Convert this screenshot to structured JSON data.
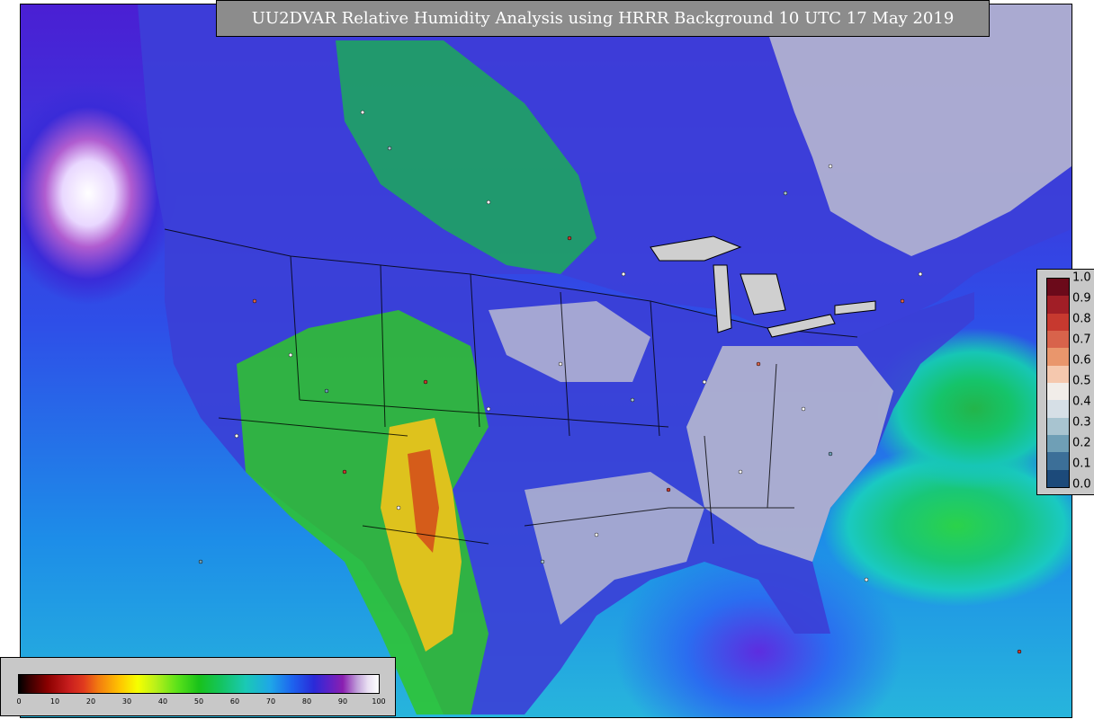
{
  "title": "UU2DVAR Relative Humidity Analysis using HRRR Background 10 UTC 17 May 2019",
  "colorbar": {
    "ticks": [
      "0",
      "10",
      "20",
      "30",
      "40",
      "50",
      "60",
      "70",
      "80",
      "90",
      "100"
    ],
    "range": [
      0,
      100
    ]
  },
  "obs_legend": {
    "ticks": [
      "1.0",
      "0.9",
      "0.8",
      "0.7",
      "0.6",
      "0.5",
      "0.4",
      "0.3",
      "0.2",
      "0.1",
      "0.0"
    ],
    "colors": [
      "#6b0a1a",
      "#a11e26",
      "#c7392f",
      "#d8634b",
      "#e9966c",
      "#f5c8ae",
      "#f1ede9",
      "#d6dfe6",
      "#a8c4d0",
      "#6f9fb6",
      "#3c6f98",
      "#1c4a7a"
    ]
  }
}
